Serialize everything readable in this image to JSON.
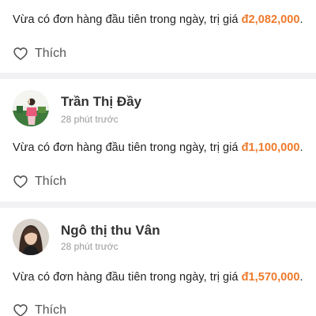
{
  "posts": [
    {
      "message": "Vừa có đơn hàng đầu tiên trong ngày, trị giá ",
      "amount": "đ2,082,000",
      "period": ".",
      "like_label": "Thích"
    },
    {
      "author": "Trần Thị Đầy",
      "time": "28 phút trước",
      "message": "Vừa có đơn hàng đầu tiên trong ngày, trị giá ",
      "amount": "đ1,100,000",
      "period": ".",
      "like_label": "Thích"
    },
    {
      "author": "Ngô thị thu Vân",
      "time": "28 phút trước",
      "message": "Vừa có đơn hàng đầu tiên trong ngày, trị giá ",
      "amount": "đ1,570,000",
      "period": ".",
      "like_label": "Thích"
    }
  ],
  "colors": {
    "amount": "#ee7a2c",
    "separator": "#f2f2f4",
    "muted": "#999999"
  },
  "icons": [
    "heart-outline-icon"
  ]
}
